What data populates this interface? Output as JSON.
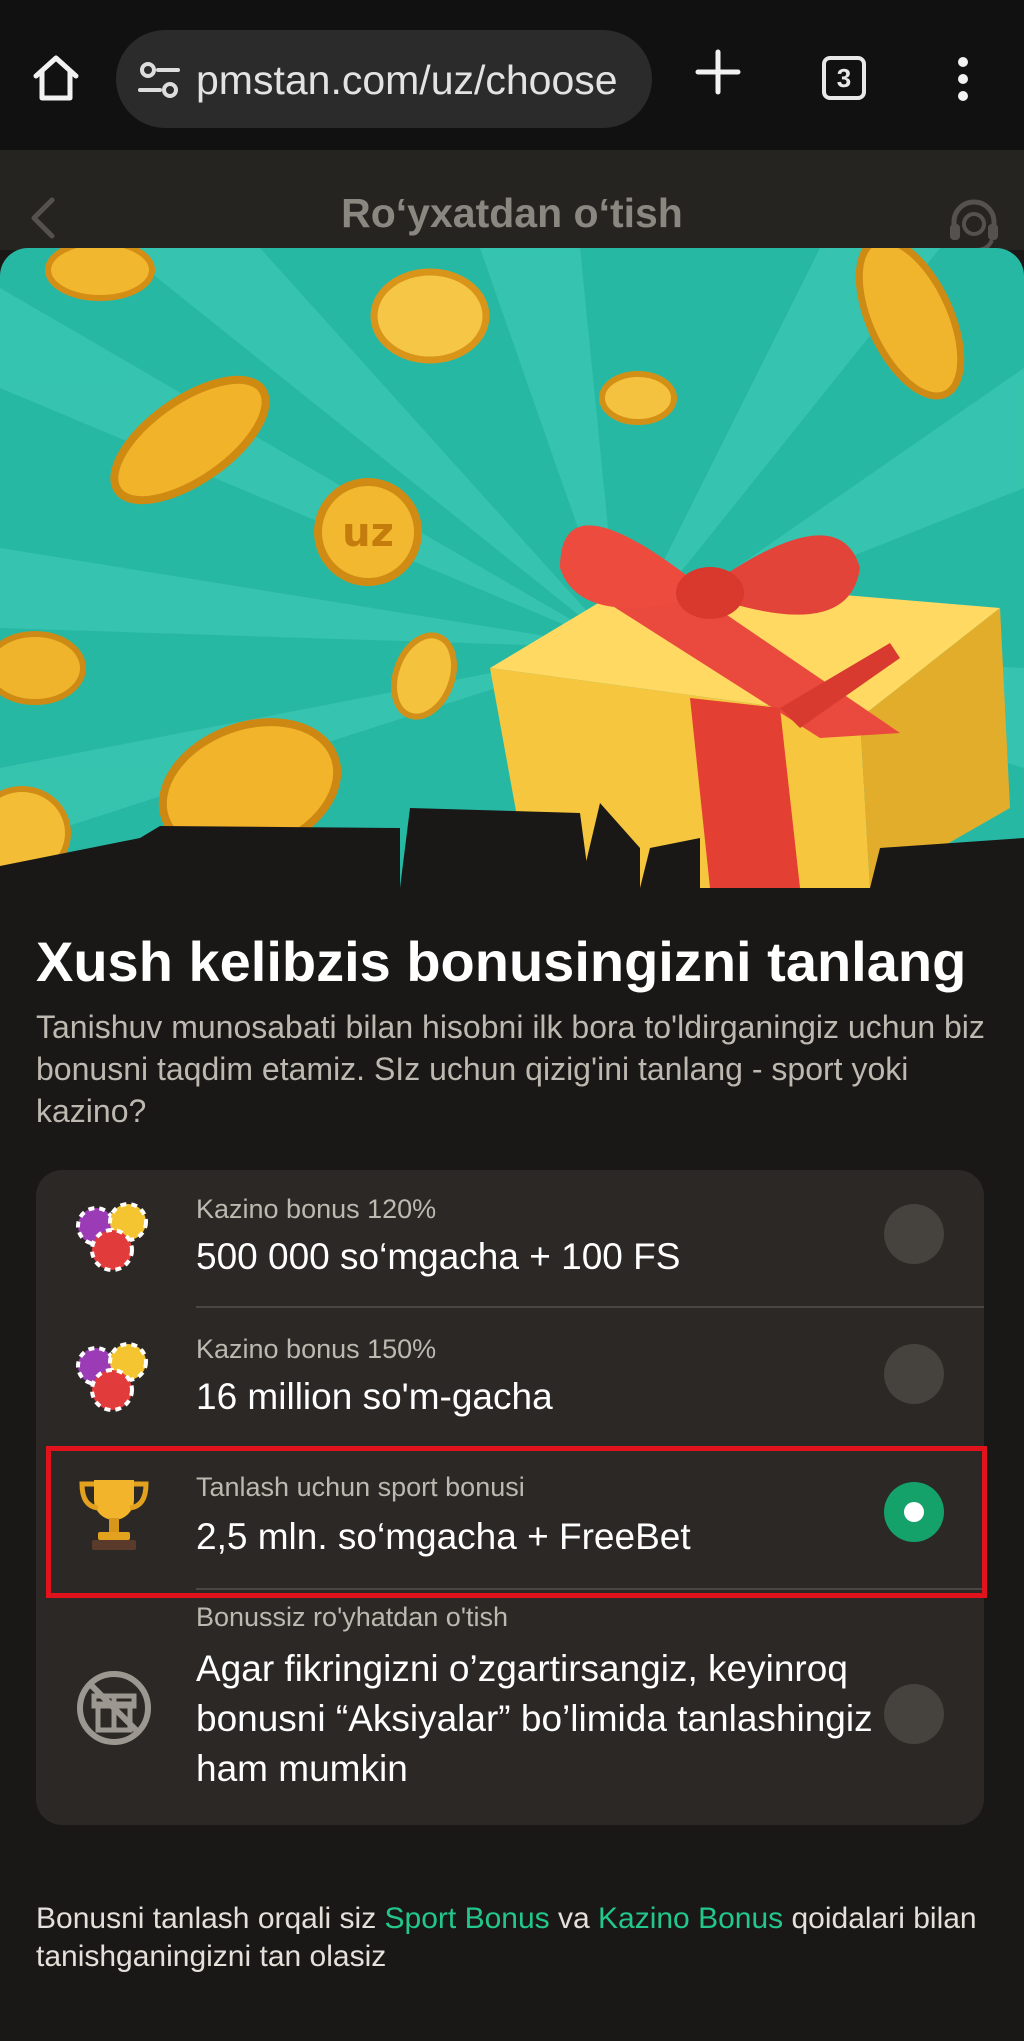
{
  "browser": {
    "url": "pmstan.com/uz/choose",
    "tab_count": "3"
  },
  "header": {
    "title": "Ro‘yxatdan o‘tish"
  },
  "main": {
    "heading": "Xush kelibzis bonusingizni tanlang",
    "subtext": "Tanishuv munosabati bilan hisobni ilk bora to'ldirganingiz uchun biz bonusni taqdim etamiz. SIz uchun qizig'ini tanlang - sport yoki kazino?"
  },
  "options": [
    {
      "small": "Kazino bonus 120%",
      "big": "500 000 so‘mgacha + 100 FS",
      "icon": "casino-chips-icon",
      "selected": false
    },
    {
      "small": "Kazino bonus 150%",
      "big": "16 million so'm-gacha",
      "icon": "casino-chips-icon",
      "selected": false
    },
    {
      "small": "Tanlash uchun sport bonusi",
      "big": "2,5 mln. so‘mgacha + FreeBet",
      "icon": "trophy-icon",
      "selected": true
    },
    {
      "small": "Bonussiz ro'yhatdan o'tish",
      "big": "Agar fikringizni o’zgartirsangiz, keyinroq bonusni “Aksiyalar” bo’limida tanlashingiz ham mumkin",
      "icon": "no-gift-icon",
      "selected": false
    }
  ],
  "footer": {
    "before": "Bonusni tanlash orqali siz ",
    "link1": "Sport Bonus",
    "middle": " va ",
    "link2": "Kazino Bonus",
    "after": " qoidalari bilan tanishganingizni tan olasiz"
  },
  "colors": {
    "accent": "#14a26a",
    "link": "#22c789",
    "banner": "#27b8a4",
    "highlight": "#e0121b"
  }
}
